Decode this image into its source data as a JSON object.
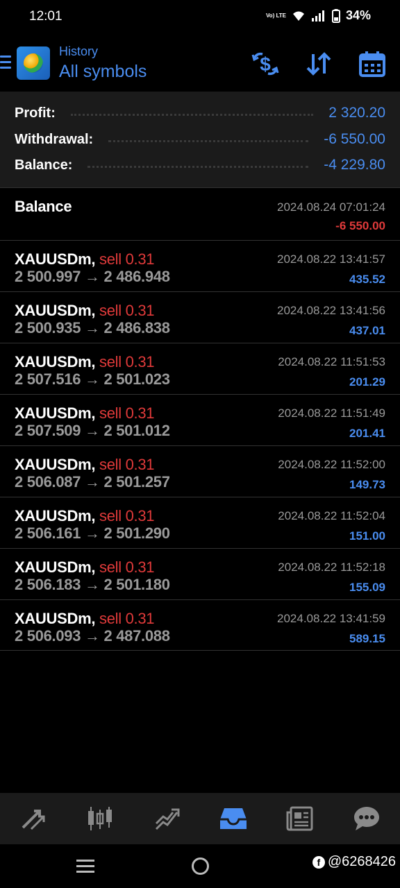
{
  "status_bar": {
    "time": "12:01",
    "volte": "Vo) LTE",
    "battery": "34%"
  },
  "header": {
    "title": "History",
    "subtitle": "All symbols",
    "actions": [
      "currency-exchange-icon",
      "sort-icon",
      "calendar-icon"
    ]
  },
  "summary": {
    "profit_label": "Profit:",
    "profit_value": "2 320.20",
    "withdrawal_label": "Withdrawal:",
    "withdrawal_value": "-6 550.00",
    "balance_label": "Balance:",
    "balance_value": "-4 229.80"
  },
  "balance_entry": {
    "title": "Balance",
    "date": "2024.08.24 07:01:24",
    "amount": "-6 550.00"
  },
  "trades": [
    {
      "symbol": "XAUUSDm,",
      "side": "sell 0.31",
      "prices": "2 500.997 → 2 486.948",
      "date": "2024.08.22 13:41:57",
      "profit": "435.52"
    },
    {
      "symbol": "XAUUSDm,",
      "side": "sell 0.31",
      "prices": "2 500.935 → 2 486.838",
      "date": "2024.08.22 13:41:56",
      "profit": "437.01"
    },
    {
      "symbol": "XAUUSDm,",
      "side": "sell 0.31",
      "prices": "2 507.516 → 2 501.023",
      "date": "2024.08.22 11:51:53",
      "profit": "201.29"
    },
    {
      "symbol": "XAUUSDm,",
      "side": "sell 0.31",
      "prices": "2 507.509 → 2 501.012",
      "date": "2024.08.22 11:51:49",
      "profit": "201.41"
    },
    {
      "symbol": "XAUUSDm,",
      "side": "sell 0.31",
      "prices": "2 506.087 → 2 501.257",
      "date": "2024.08.22 11:52:00",
      "profit": "149.73"
    },
    {
      "symbol": "XAUUSDm,",
      "side": "sell 0.31",
      "prices": "2 506.161 → 2 501.290",
      "date": "2024.08.22 11:52:04",
      "profit": "151.00"
    },
    {
      "symbol": "XAUUSDm,",
      "side": "sell 0.31",
      "prices": "2 506.183 → 2 501.180",
      "date": "2024.08.22 11:52:18",
      "profit": "155.09"
    },
    {
      "symbol": "XAUUSDm,",
      "side": "sell 0.31",
      "prices": "2 506.093 → 2 487.088",
      "date": "2024.08.22 13:41:59",
      "profit": "589.15"
    }
  ],
  "bottom_nav": [
    "quotes-icon",
    "chart-icon",
    "trade-icon",
    "history-icon",
    "news-icon",
    "chat-icon"
  ],
  "watermark": "@6268426",
  "colors": {
    "accent": "#4a8df0",
    "negative": "#e03a3a",
    "muted": "#9a9a9a",
    "panel": "#1b1b1b"
  }
}
